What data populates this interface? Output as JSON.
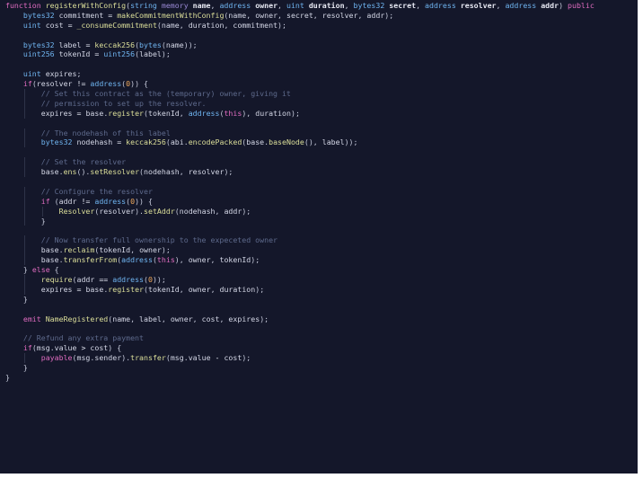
{
  "editor": {
    "colors": {
      "background": "#14172a",
      "keyword": "#e06cc0",
      "type": "#6fb4f0",
      "function": "#dcdf9a",
      "comment": "#5e6a8c",
      "number": "#f0a85a",
      "text": "#d4d7e6"
    },
    "lines": [
      [
        [
          "kw",
          "function "
        ],
        [
          "fn",
          "registerWithConfig"
        ],
        [
          "pn",
          "("
        ],
        [
          "type",
          "string "
        ],
        [
          "mod",
          "memory "
        ],
        [
          "tw",
          "name"
        ],
        [
          "pn",
          ", "
        ],
        [
          "type",
          "address "
        ],
        [
          "tw",
          "owner"
        ],
        [
          "pn",
          ", "
        ],
        [
          "type",
          "uint "
        ],
        [
          "tw",
          "duration"
        ],
        [
          "pn",
          ", "
        ],
        [
          "type",
          "bytes32 "
        ],
        [
          "tw",
          "secret"
        ],
        [
          "pn",
          ", "
        ],
        [
          "type",
          "address "
        ],
        [
          "tw",
          "resolver"
        ],
        [
          "pn",
          ", "
        ],
        [
          "type",
          "address "
        ],
        [
          "tw",
          "addr"
        ],
        [
          "pn",
          ") "
        ],
        [
          "kw",
          "public"
        ]
      ],
      [
        [
          "type",
          "bytes32 "
        ],
        [
          "id",
          "commitment "
        ],
        [
          "op",
          "= "
        ],
        [
          "fn",
          "makeCommitmentWithConfig"
        ],
        [
          "pn",
          "("
        ],
        [
          "id",
          "name"
        ],
        [
          "pn",
          ", "
        ],
        [
          "id",
          "owner"
        ],
        [
          "pn",
          ", "
        ],
        [
          "id",
          "secret"
        ],
        [
          "pn",
          ", "
        ],
        [
          "id",
          "resolver"
        ],
        [
          "pn",
          ", "
        ],
        [
          "id",
          "addr"
        ],
        [
          "pn",
          ");"
        ]
      ],
      [
        [
          "type",
          "uint "
        ],
        [
          "id",
          "cost "
        ],
        [
          "op",
          "= "
        ],
        [
          "fn",
          "_consumeCommitment"
        ],
        [
          "pn",
          "("
        ],
        [
          "id",
          "name"
        ],
        [
          "pn",
          ", "
        ],
        [
          "id",
          "duration"
        ],
        [
          "pn",
          ", "
        ],
        [
          "id",
          "commitment"
        ],
        [
          "pn",
          ");"
        ]
      ],
      [],
      [
        [
          "type",
          "bytes32 "
        ],
        [
          "id",
          "label "
        ],
        [
          "op",
          "= "
        ],
        [
          "fn",
          "keccak256"
        ],
        [
          "pn",
          "("
        ],
        [
          "type",
          "bytes"
        ],
        [
          "pn",
          "("
        ],
        [
          "id",
          "name"
        ],
        [
          "pn",
          "));"
        ]
      ],
      [
        [
          "type",
          "uint256 "
        ],
        [
          "id",
          "tokenId "
        ],
        [
          "op",
          "= "
        ],
        [
          "type",
          "uint256"
        ],
        [
          "pn",
          "("
        ],
        [
          "id",
          "label"
        ],
        [
          "pn",
          ");"
        ]
      ],
      [],
      [
        [
          "type",
          "uint "
        ],
        [
          "id",
          "expires"
        ],
        [
          "pn",
          ";"
        ]
      ],
      [
        [
          "kw",
          "if"
        ],
        [
          "pn",
          "("
        ],
        [
          "id",
          "resolver "
        ],
        [
          "op",
          "!= "
        ],
        [
          "type",
          "address"
        ],
        [
          "pn",
          "("
        ],
        [
          "num",
          "0"
        ],
        [
          "pn",
          ")) {"
        ]
      ],
      [
        [
          "cm",
          "// Set this contract as the (temporary) owner, giving it"
        ]
      ],
      [
        [
          "cm",
          "// permission to set up the resolver."
        ]
      ],
      [
        [
          "id",
          "expires "
        ],
        [
          "op",
          "= "
        ],
        [
          "id",
          "base"
        ],
        [
          "pn",
          "."
        ],
        [
          "fn",
          "register"
        ],
        [
          "pn",
          "("
        ],
        [
          "id",
          "tokenId"
        ],
        [
          "pn",
          ", "
        ],
        [
          "type",
          "address"
        ],
        [
          "pn",
          "("
        ],
        [
          "kw",
          "this"
        ],
        [
          "pn",
          "), "
        ],
        [
          "id",
          "duration"
        ],
        [
          "pn",
          ");"
        ]
      ],
      [],
      [
        [
          "cm",
          "// The nodehash of this label"
        ]
      ],
      [
        [
          "type",
          "bytes32 "
        ],
        [
          "id",
          "nodehash "
        ],
        [
          "op",
          "= "
        ],
        [
          "fn",
          "keccak256"
        ],
        [
          "pn",
          "("
        ],
        [
          "id",
          "abi"
        ],
        [
          "pn",
          "."
        ],
        [
          "fn",
          "encodePacked"
        ],
        [
          "pn",
          "("
        ],
        [
          "id",
          "base"
        ],
        [
          "pn",
          "."
        ],
        [
          "fn",
          "baseNode"
        ],
        [
          "pn",
          "(), "
        ],
        [
          "id",
          "label"
        ],
        [
          "pn",
          "));"
        ]
      ],
      [],
      [
        [
          "cm",
          "// Set the resolver"
        ]
      ],
      [
        [
          "id",
          "base"
        ],
        [
          "pn",
          "."
        ],
        [
          "fn",
          "ens"
        ],
        [
          "pn",
          "()."
        ],
        [
          "fn",
          "setResolver"
        ],
        [
          "pn",
          "("
        ],
        [
          "id",
          "nodehash"
        ],
        [
          "pn",
          ", "
        ],
        [
          "id",
          "resolver"
        ],
        [
          "pn",
          ");"
        ]
      ],
      [],
      [
        [
          "cm",
          "// Configure the resolver"
        ]
      ],
      [
        [
          "kw",
          "if "
        ],
        [
          "pn",
          "("
        ],
        [
          "id",
          "addr "
        ],
        [
          "op",
          "!= "
        ],
        [
          "type",
          "address"
        ],
        [
          "pn",
          "("
        ],
        [
          "num",
          "0"
        ],
        [
          "pn",
          ")) {"
        ]
      ],
      [
        [
          "fn",
          "Resolver"
        ],
        [
          "pn",
          "("
        ],
        [
          "id",
          "resolver"
        ],
        [
          "pn",
          ")."
        ],
        [
          "fn",
          "setAddr"
        ],
        [
          "pn",
          "("
        ],
        [
          "id",
          "nodehash"
        ],
        [
          "pn",
          ", "
        ],
        [
          "id",
          "addr"
        ],
        [
          "pn",
          ");"
        ]
      ],
      [
        [
          "pn",
          "}"
        ]
      ],
      [],
      [
        [
          "cm",
          "// Now transfer full ownership to the expeceted owner"
        ]
      ],
      [
        [
          "id",
          "base"
        ],
        [
          "pn",
          "."
        ],
        [
          "fn",
          "reclaim"
        ],
        [
          "pn",
          "("
        ],
        [
          "id",
          "tokenId"
        ],
        [
          "pn",
          ", "
        ],
        [
          "id",
          "owner"
        ],
        [
          "pn",
          ");"
        ]
      ],
      [
        [
          "id",
          "base"
        ],
        [
          "pn",
          "."
        ],
        [
          "fn",
          "transferFrom"
        ],
        [
          "pn",
          "("
        ],
        [
          "type",
          "address"
        ],
        [
          "pn",
          "("
        ],
        [
          "kw",
          "this"
        ],
        [
          "pn",
          "), "
        ],
        [
          "id",
          "owner"
        ],
        [
          "pn",
          ", "
        ],
        [
          "id",
          "tokenId"
        ],
        [
          "pn",
          ");"
        ]
      ],
      [
        [
          "pn",
          "} "
        ],
        [
          "kw",
          "else "
        ],
        [
          "pn",
          "{"
        ]
      ],
      [
        [
          "fn",
          "require"
        ],
        [
          "pn",
          "("
        ],
        [
          "id",
          "addr "
        ],
        [
          "op",
          "== "
        ],
        [
          "type",
          "address"
        ],
        [
          "pn",
          "("
        ],
        [
          "num",
          "0"
        ],
        [
          "pn",
          "));"
        ]
      ],
      [
        [
          "id",
          "expires "
        ],
        [
          "op",
          "= "
        ],
        [
          "id",
          "base"
        ],
        [
          "pn",
          "."
        ],
        [
          "fn",
          "register"
        ],
        [
          "pn",
          "("
        ],
        [
          "id",
          "tokenId"
        ],
        [
          "pn",
          ", "
        ],
        [
          "id",
          "owner"
        ],
        [
          "pn",
          ", "
        ],
        [
          "id",
          "duration"
        ],
        [
          "pn",
          ");"
        ]
      ],
      [
        [
          "pn",
          "}"
        ]
      ],
      [],
      [
        [
          "kw",
          "emit "
        ],
        [
          "fn",
          "NameRegistered"
        ],
        [
          "pn",
          "("
        ],
        [
          "id",
          "name"
        ],
        [
          "pn",
          ", "
        ],
        [
          "id",
          "label"
        ],
        [
          "pn",
          ", "
        ],
        [
          "id",
          "owner"
        ],
        [
          "pn",
          ", "
        ],
        [
          "id",
          "cost"
        ],
        [
          "pn",
          ", "
        ],
        [
          "id",
          "expires"
        ],
        [
          "pn",
          ");"
        ]
      ],
      [],
      [
        [
          "cm",
          "// Refund any extra payment"
        ]
      ],
      [
        [
          "kw",
          "if"
        ],
        [
          "pn",
          "("
        ],
        [
          "id",
          "msg"
        ],
        [
          "pn",
          "."
        ],
        [
          "id",
          "value "
        ],
        [
          "op",
          "> "
        ],
        [
          "id",
          "cost"
        ],
        [
          "pn",
          ") {"
        ]
      ],
      [
        [
          "kw",
          "payable"
        ],
        [
          "pn",
          "("
        ],
        [
          "id",
          "msg"
        ],
        [
          "pn",
          "."
        ],
        [
          "id",
          "sender"
        ],
        [
          "pn",
          ")."
        ],
        [
          "fn",
          "transfer"
        ],
        [
          "pn",
          "("
        ],
        [
          "id",
          "msg"
        ],
        [
          "pn",
          "."
        ],
        [
          "id",
          "value "
        ],
        [
          "op",
          "- "
        ],
        [
          "id",
          "cost"
        ],
        [
          "pn",
          ");"
        ]
      ],
      [
        [
          "pn",
          "}"
        ]
      ],
      [
        [
          "pn",
          "}"
        ]
      ]
    ]
  }
}
